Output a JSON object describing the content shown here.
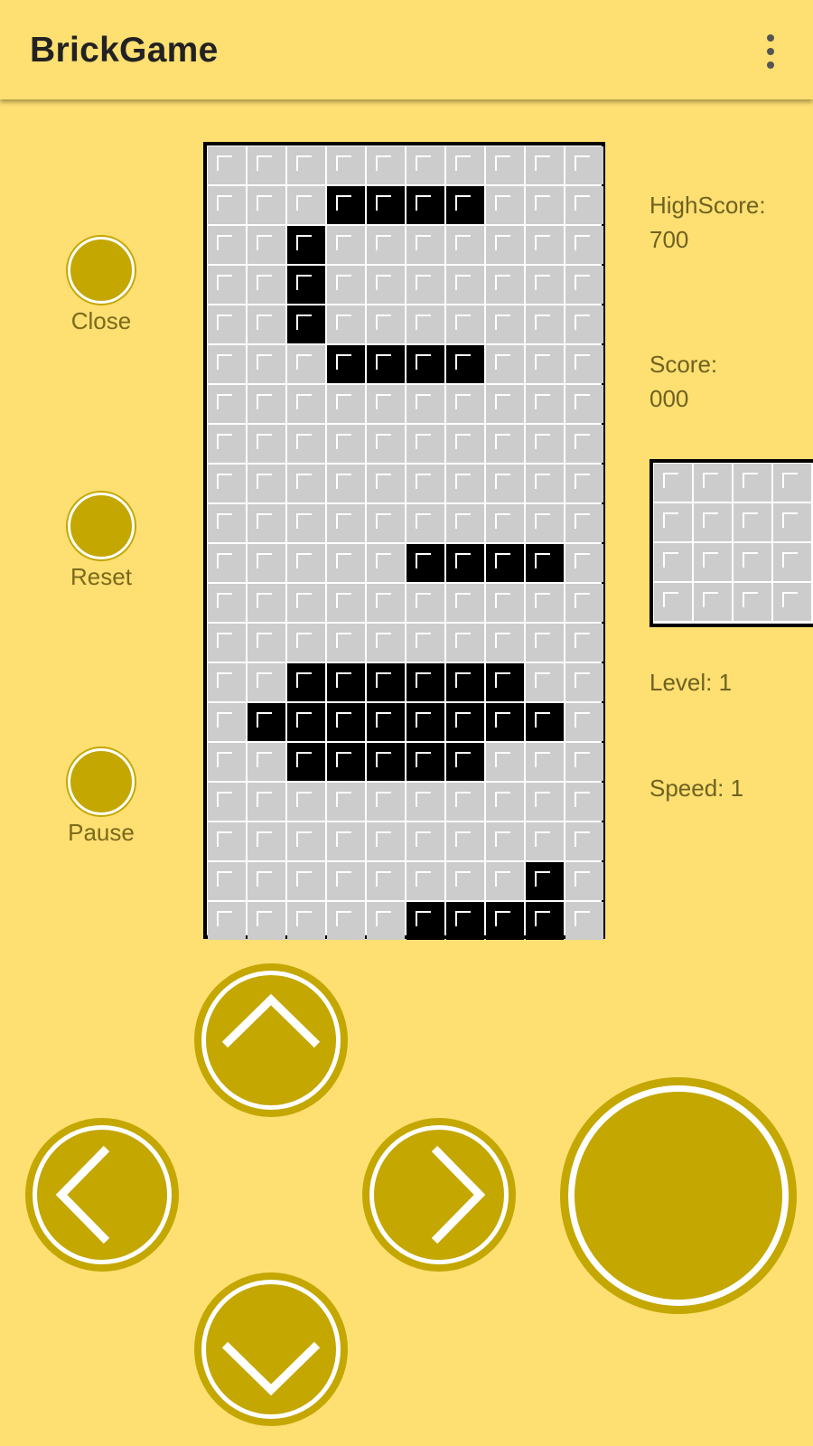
{
  "app": {
    "title": "BrickGame"
  },
  "side_buttons": [
    {
      "label": "Close"
    },
    {
      "label": "Reset"
    },
    {
      "label": "Pause"
    }
  ],
  "stats": {
    "highscore_label": "HighScore:",
    "highscore_value": "700",
    "score_label": "Score:",
    "score_value": "000",
    "level_label": "Level:",
    "level_value": "1",
    "speed_label": "Speed:",
    "speed_value": "1"
  },
  "board": {
    "rows": [
      "0000000000",
      "0001111000",
      "0010000000",
      "0010000000",
      "0010000000",
      "0001111000",
      "0000000000",
      "0000000000",
      "0000000000",
      "0000000000",
      "0000011110",
      "0000000000",
      "0000000000",
      "0011111100",
      "0111111110",
      "0011111000",
      "0000000000",
      "0000000000",
      "0000000010",
      "0000011110"
    ]
  },
  "next_preview": {
    "rows": [
      "0000",
      "0000",
      "0000",
      "0000"
    ]
  },
  "controls": {
    "up": "arrow-up-icon",
    "left": "arrow-left-icon",
    "right": "arrow-right-icon",
    "down": "arrow-down-icon",
    "action": "rotate-action-button"
  },
  "colors": {
    "background": "#FDDF72",
    "button": "#C4A700",
    "cell_off": "#CCCCCC",
    "cell_on": "#000000"
  }
}
